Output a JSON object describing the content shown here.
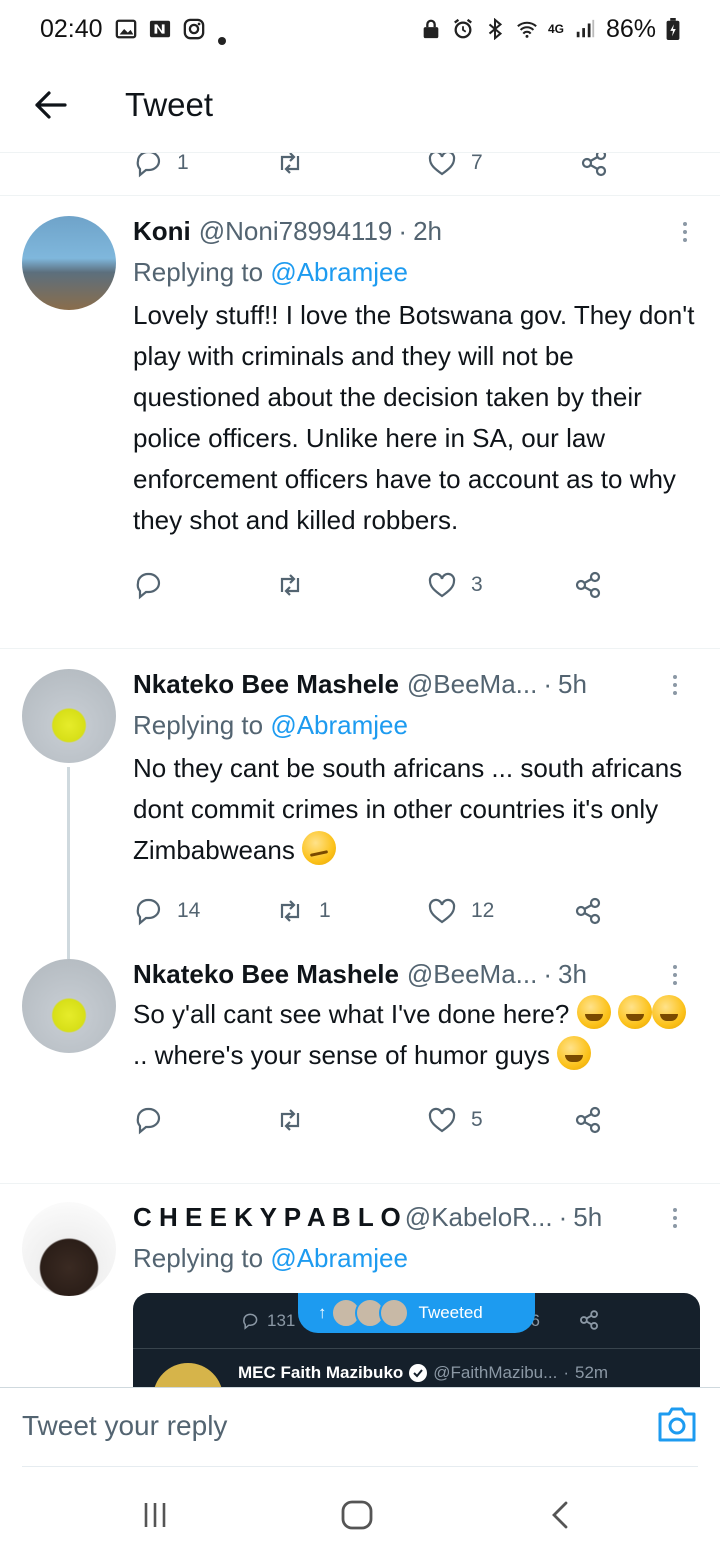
{
  "status_bar": {
    "time": "02:40",
    "battery": "86%",
    "network": "4G",
    "icons_left": [
      "gallery-icon",
      "n-app-icon",
      "instagram-icon",
      "dot-icon"
    ],
    "icons_right": [
      "lock-icon",
      "alarm-icon",
      "bluetooth-icon",
      "wifi-icon",
      "signal-icon",
      "battery-icon"
    ]
  },
  "header": {
    "title": "Tweet"
  },
  "partial_tweet": {
    "reply_count": "1",
    "like_count": "7"
  },
  "tweets": [
    {
      "name": "Koni",
      "handle": "@Noni78994119",
      "time": "2h",
      "replying_prefix": "Replying to ",
      "replying_to": "@Abramjee",
      "text": "Lovely stuff!! I love the Botswana gov. They don't play with criminals and they will not be questioned about the decision taken by their police officers. Unlike here in SA, our law enforcement officers have to account as to why they shot and killed robbers.",
      "replies": "",
      "retweets": "",
      "likes": "3"
    },
    {
      "name": "Nkateko Bee Mashele",
      "handle": "@BeeMa...",
      "time": "5h",
      "replying_prefix": "Replying to ",
      "replying_to": "@Abramjee",
      "text": "No they cant be south africans ... south africans dont commit crimes in other countries  it's only Zimbabweans",
      "replies": "14",
      "retweets": "1",
      "likes": "12"
    },
    {
      "name": "Nkateko Bee Mashele",
      "handle": "@BeeMa...",
      "time": "3h",
      "text_part1": "So y'all cant see what I've done here?",
      "text_part2": " .. where's your sense of humor guys",
      "replies": "",
      "retweets": "",
      "likes": "5"
    },
    {
      "name": "C H E E K Y P A B L O",
      "handle": "@KabeloR...",
      "time": "5h",
      "replying_prefix": "Replying to ",
      "replying_to": "@Abramjee"
    }
  ],
  "embedded_image": {
    "replies": "131",
    "pill_label": "Tweeted",
    "likes_partial": "26",
    "name": "MEC Faith Mazibuko",
    "handle": "@FaithMazibu...",
    "time": "52m"
  },
  "composer": {
    "placeholder": "Tweet your reply"
  },
  "colors": {
    "accent": "#1d9bf0",
    "muted": "#536471",
    "text": "#0f1419"
  }
}
